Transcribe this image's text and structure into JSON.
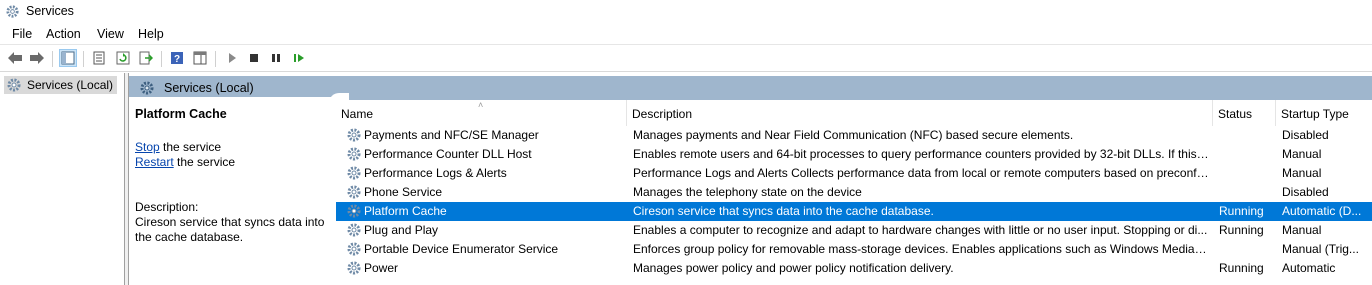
{
  "window": {
    "title": "Services",
    "icon": "gear-icon"
  },
  "menu": [
    "File",
    "Action",
    "View",
    "Help"
  ],
  "toolbar": {
    "buttons": [
      "back-arrow-icon",
      "forward-arrow-icon",
      "console-tree-icon",
      "properties-icon",
      "refresh-icon",
      "export-list-icon",
      "help-icon",
      "action-pane-icon",
      "start-icon",
      "stop-icon",
      "pause-icon",
      "resume-icon"
    ]
  },
  "tree": {
    "root": "Services (Local)"
  },
  "pane": {
    "header": "Services (Local)",
    "selected_service": "Platform Cache",
    "stop_link": "Stop",
    "stop_suffix": " the service",
    "restart_link": "Restart",
    "restart_suffix": " the service",
    "description_label": "Description:",
    "description_text": "Cireson service that syncs data into the cache database."
  },
  "list": {
    "columns": [
      "Name",
      "Description",
      "Status",
      "Startup Type"
    ],
    "rows": [
      {
        "name": "Payments and NFC/SE Manager",
        "description": "Manages payments and Near Field Communication (NFC) based secure elements.",
        "status": "",
        "startup": "Disabled"
      },
      {
        "name": "Performance Counter DLL Host",
        "description": "Enables remote users and 64-bit processes to query performance counters provided by 32-bit DLLs. If this s...",
        "status": "",
        "startup": "Manual"
      },
      {
        "name": "Performance Logs & Alerts",
        "description": "Performance Logs and Alerts Collects performance data from local or remote computers based on preconfi...",
        "status": "",
        "startup": "Manual"
      },
      {
        "name": "Phone Service",
        "description": "Manages the telephony state on the device",
        "status": "",
        "startup": "Disabled"
      },
      {
        "name": "Platform Cache",
        "description": "Cireson service that syncs data into the cache database.",
        "status": "Running",
        "startup": "Automatic (D...",
        "selected": true
      },
      {
        "name": "Plug and Play",
        "description": "Enables a computer to recognize and adapt to hardware changes with little or no user input. Stopping or di...",
        "status": "Running",
        "startup": "Manual"
      },
      {
        "name": "Portable Device Enumerator Service",
        "description": "Enforces group policy for removable mass-storage devices. Enables applications such as Windows Media Pl...",
        "status": "",
        "startup": "Manual (Trig..."
      },
      {
        "name": "Power",
        "description": "Manages power policy and power policy notification delivery.",
        "status": "Running",
        "startup": "Automatic"
      }
    ]
  },
  "colors": {
    "selection": "#0078d7",
    "header_band": "#9fb6cd",
    "link": "#0645ad"
  }
}
